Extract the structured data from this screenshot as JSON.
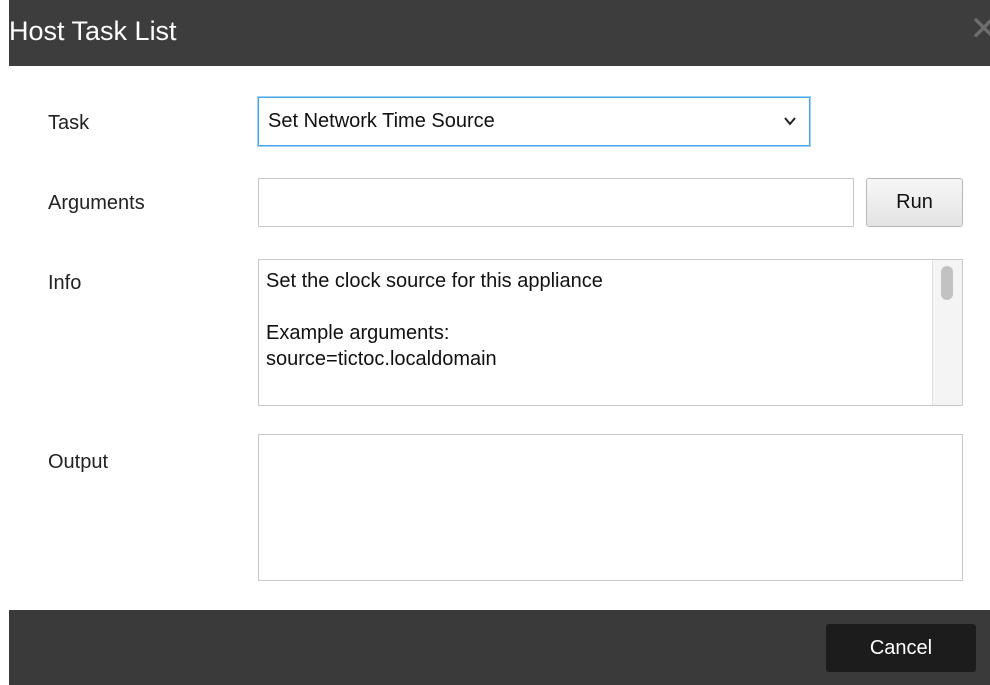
{
  "window": {
    "title": "Host Task List",
    "close_icon": "close-icon"
  },
  "form": {
    "task_label": "Task",
    "task_selected": "Set Network Time Source",
    "arguments_label": "Arguments",
    "arguments_value": "",
    "arguments_placeholder": "",
    "run_label": "Run",
    "info_label": "Info",
    "info_text": "Set the clock source for this appliance\n\nExample arguments:\nsource=tictoc.localdomain",
    "output_label": "Output",
    "output_value": ""
  },
  "footer": {
    "cancel_label": "Cancel"
  },
  "colors": {
    "titlebar": "#3d3d3d",
    "footer": "#3a3a3a",
    "focus_border": "#4aa7e8",
    "cancel_bg": "#1c1c1c"
  }
}
